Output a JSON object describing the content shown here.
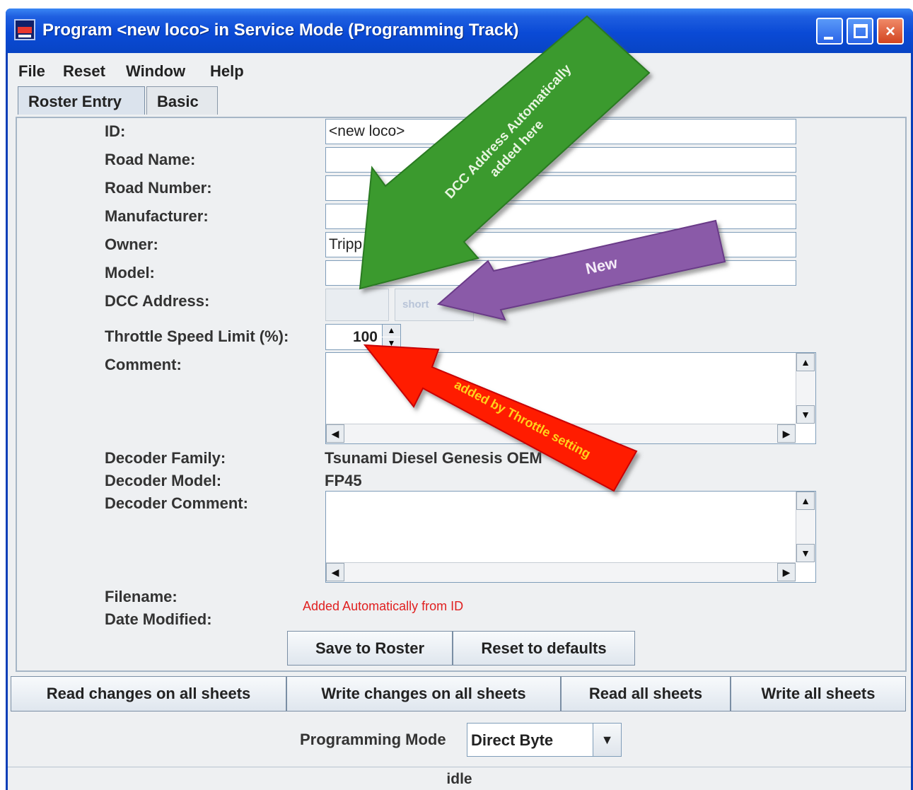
{
  "window": {
    "title": "Program <new loco> in Service Mode (Programming Track)"
  },
  "window_buttons": {
    "minimize": "_",
    "maximize": "□",
    "close": "×"
  },
  "menu": [
    "File",
    "Reset",
    "Window",
    "Help"
  ],
  "tabs": [
    {
      "label": "Roster Entry",
      "active": true
    },
    {
      "label": "Basic",
      "active": false
    }
  ],
  "form": {
    "id_label": "ID:",
    "id_value": "<new loco>",
    "road_name_label": "Road Name:",
    "road_name_value": "",
    "road_number_label": "Road Number:",
    "road_number_value": "",
    "manufacturer_label": "Manufacturer:",
    "manufacturer_value": "",
    "owner_label": "Owner:",
    "owner_value": "Tripp",
    "model_label": "Model:",
    "model_value": "",
    "dcc_address_label": "DCC Address:",
    "dcc_address_value": "",
    "dcc_address_type": "short",
    "throttle_label": "Throttle Speed Limit (%):",
    "throttle_value": "100",
    "comment_label": "Comment:",
    "decoder_family_label": "Decoder Family:",
    "decoder_family_value": "Tsunami Diesel Genesis OEM",
    "decoder_model_label": "Decoder Model:",
    "decoder_model_value": "FP45",
    "decoder_comment_label": "Decoder Comment:",
    "filename_label": "Filename:",
    "date_modified_label": "Date Modified:",
    "filename_note": "Added Automatically from ID"
  },
  "buttons": {
    "save": "Save to Roster",
    "reset": "Reset to defaults",
    "read_changes": "Read changes on all sheets",
    "write_changes": "Write changes on all sheets",
    "read_all": "Read all sheets",
    "write_all": "Write all sheets"
  },
  "programming": {
    "label": "Programming Mode",
    "value": "Direct Byte"
  },
  "status": "idle",
  "annotations": {
    "green": [
      "DCC Address Automatically",
      "added here"
    ],
    "purple": "New",
    "red": "added by Throttle setting"
  },
  "colors": {
    "title_bar": "#0a4ad6",
    "green_arrow": "#3a9a2e",
    "purple_arrow": "#8a5aa8",
    "red_arrow": "#ff1a00",
    "red_note": "#e02020",
    "red_arrow_text": "#ffd21a"
  },
  "icons": {
    "spinner_up": "▲",
    "spinner_down": "▼",
    "scroll_up": "▲",
    "scroll_down": "▼",
    "scroll_left": "◀",
    "scroll_right": "▶",
    "combo_arrow": "▼"
  }
}
